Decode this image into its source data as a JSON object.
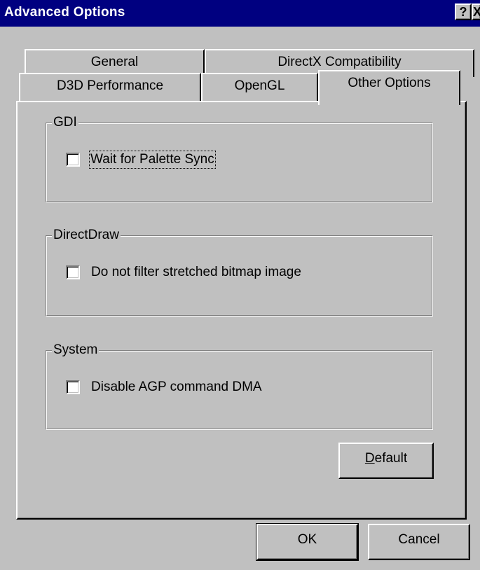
{
  "window": {
    "title": "Advanced Options",
    "help_glyph": "?",
    "close_glyph": "X",
    "title_bar_color": "#000080",
    "face_color": "#c0c0c0"
  },
  "tabs": {
    "row_back": [
      "General",
      "DirectX Compatibility"
    ],
    "row_front": [
      "D3D Performance",
      "OpenGL",
      "Other Options"
    ],
    "active": "Other Options"
  },
  "groups": {
    "gdi": {
      "title": "GDI",
      "checkbox_label": "Wait for Palette Sync",
      "checked": false
    },
    "directdraw": {
      "title": "DirectDraw",
      "checkbox_label": "Do not filter stretched bitmap image",
      "checked": false
    },
    "system": {
      "title": "System",
      "checkbox_label": "Disable AGP command DMA",
      "checked": false
    }
  },
  "buttons": {
    "default_accel": "D",
    "default_rest": "efault",
    "ok": "OK",
    "cancel": "Cancel"
  }
}
